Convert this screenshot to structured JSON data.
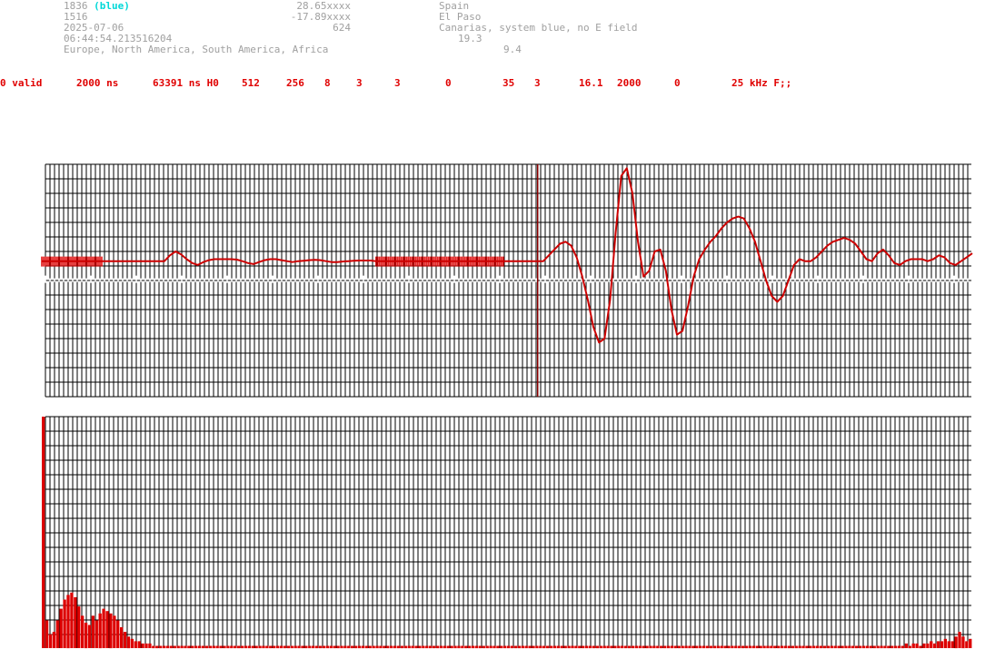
{
  "header": {
    "line1": {
      "id": "1836",
      "tag": "(blue)",
      "coord": "28.65xxxx",
      "place": "Spain"
    },
    "line2": {
      "id": "1516",
      "coord": "-17.89xxxx",
      "place": "El Paso"
    },
    "line3": {
      "date": "2025-07-06",
      "value": "624",
      "place": "Canarias, system blue, no E field"
    },
    "line4": {
      "time": "06:44:54.213516204",
      "value": "19.3"
    },
    "line5": {
      "regions": "Europe, North America, South America, Africa",
      "value": "9.4"
    }
  },
  "status": {
    "s1": "0 valid",
    "s2": "2000 ns",
    "s3": "63391 ns H0",
    "s4": "512",
    "s5": "256",
    "s6": "8",
    "s7": "3",
    "s8": "3",
    "s9": "0",
    "s10": "35",
    "s11": "3",
    "s12": "16.1",
    "s13": "2000",
    "s14": "0",
    "s15": "25 kHz F;;"
  },
  "chart_data": [
    {
      "type": "line",
      "series": [
        {
          "values": [
            0,
            0,
            0,
            0,
            0,
            0,
            0,
            0,
            0,
            0,
            0,
            0,
            0,
            0,
            0,
            0,
            0,
            0,
            0,
            0,
            0,
            0,
            0,
            0.3,
            0.5,
            0.35,
            0.1,
            -0.1,
            -0.2,
            -0.05,
            0.05,
            0.1,
            0.1,
            0.1,
            0.1,
            0.08,
            0,
            -0.1,
            -0.15,
            -0.05,
            0.05,
            0.1,
            0.1,
            0.05,
            0,
            -0.05,
            0,
            0.02,
            0.05,
            0.07,
            0.05,
            0,
            -0.05,
            -0.05,
            -0.02,
            0,
            0.02,
            0.03,
            0.03,
            0.03,
            0,
            0,
            0,
            0,
            0,
            0,
            0,
            0,
            0,
            0,
            0,
            0,
            0,
            0,
            0,
            0,
            0,
            0,
            0,
            0,
            0,
            0,
            0,
            0,
            0,
            0,
            0,
            0,
            0,
            0,
            0,
            0.3,
            0.6,
            0.9,
            1.0,
            0.8,
            0.2,
            -0.8,
            -2.0,
            -3.4,
            -4.2,
            -4.0,
            -2.0,
            1.5,
            4.4,
            4.8,
            3.5,
            1.0,
            -0.8,
            -0.5,
            0.5,
            0.6,
            -0.5,
            -2.5,
            -3.8,
            -3.6,
            -2.3,
            -0.8,
            0.1,
            0.6,
            1.0,
            1.3,
            1.7,
            2.0,
            2.2,
            2.3,
            2.2,
            1.7,
            1.0,
            0,
            -1.0,
            -1.8,
            -2.1,
            -1.8,
            -1.0,
            -0.2,
            0.1,
            0,
            0,
            0.2,
            0.5,
            0.8,
            1.0,
            1.1,
            1.2,
            1.1,
            0.9,
            0.5,
            0.1,
            0,
            0.4,
            0.6,
            0.3,
            -0.1,
            -0.2,
            0,
            0.1,
            0.1,
            0.1,
            0,
            0.1,
            0.3,
            0.2,
            -0.1,
            -0.2,
            0,
            0.2,
            0.4
          ]
        }
      ],
      "marked_ranges": [
        [
          0,
          11
        ],
        [
          60,
          83
        ]
      ],
      "cursor_index": 89,
      "ylim": [
        -7,
        5
      ],
      "grid": true
    },
    {
      "type": "bar",
      "values": [
        100,
        12,
        6,
        7,
        12,
        17,
        21,
        23,
        24,
        22,
        18,
        14,
        11,
        10,
        14,
        12,
        15,
        17,
        16,
        15,
        14,
        12,
        9,
        7,
        5,
        4,
        3,
        3,
        2,
        2,
        2,
        1,
        1,
        1,
        1,
        1,
        1,
        1,
        1,
        1,
        1,
        1,
        1,
        1,
        1,
        1,
        1,
        1,
        1,
        1,
        1,
        1,
        1,
        1,
        1,
        1,
        1,
        1,
        1,
        1,
        1,
        1,
        1,
        1,
        1,
        1,
        1,
        1,
        1,
        1,
        1,
        1,
        1,
        1,
        1,
        1,
        1,
        1,
        1,
        1,
        1,
        1,
        1,
        1,
        1,
        1,
        1,
        1,
        1,
        1,
        1,
        1,
        1,
        1,
        1,
        1,
        1,
        1,
        1,
        1,
        1,
        1,
        1,
        1,
        1,
        1,
        1,
        1,
        1,
        1,
        1,
        1,
        1,
        1,
        1,
        1,
        1,
        1,
        1,
        1,
        1,
        1,
        1,
        1,
        1,
        1,
        1,
        1,
        1,
        1,
        1,
        1,
        1,
        1,
        1,
        1,
        1,
        1,
        1,
        1,
        1,
        1,
        1,
        1,
        1,
        1,
        1,
        1,
        1,
        1,
        1,
        1,
        1,
        1,
        1,
        1,
        1,
        1,
        1,
        1,
        1,
        1,
        1,
        1,
        1,
        1,
        1,
        1,
        1,
        1,
        1,
        1,
        1,
        1,
        1,
        1,
        1,
        1,
        1,
        1,
        1,
        1,
        1,
        1,
        1,
        1,
        1,
        1,
        1,
        1,
        1,
        1,
        1,
        1,
        1,
        1,
        1,
        1,
        1,
        1,
        1,
        1,
        1,
        1,
        1,
        1,
        1,
        1,
        1,
        1,
        1,
        1,
        1,
        1,
        1,
        1,
        1,
        1,
        1,
        1,
        1,
        1,
        1,
        1,
        1,
        1,
        1,
        1,
        1,
        1,
        1,
        1,
        1,
        1,
        1,
        1,
        1,
        1,
        1,
        1,
        1,
        1,
        1,
        2,
        1,
        2,
        2,
        1,
        2,
        2,
        3,
        2,
        3,
        3,
        4,
        3,
        3,
        5,
        7,
        5,
        3,
        4
      ],
      "ylim": [
        0,
        100
      ],
      "grid": true
    }
  ]
}
